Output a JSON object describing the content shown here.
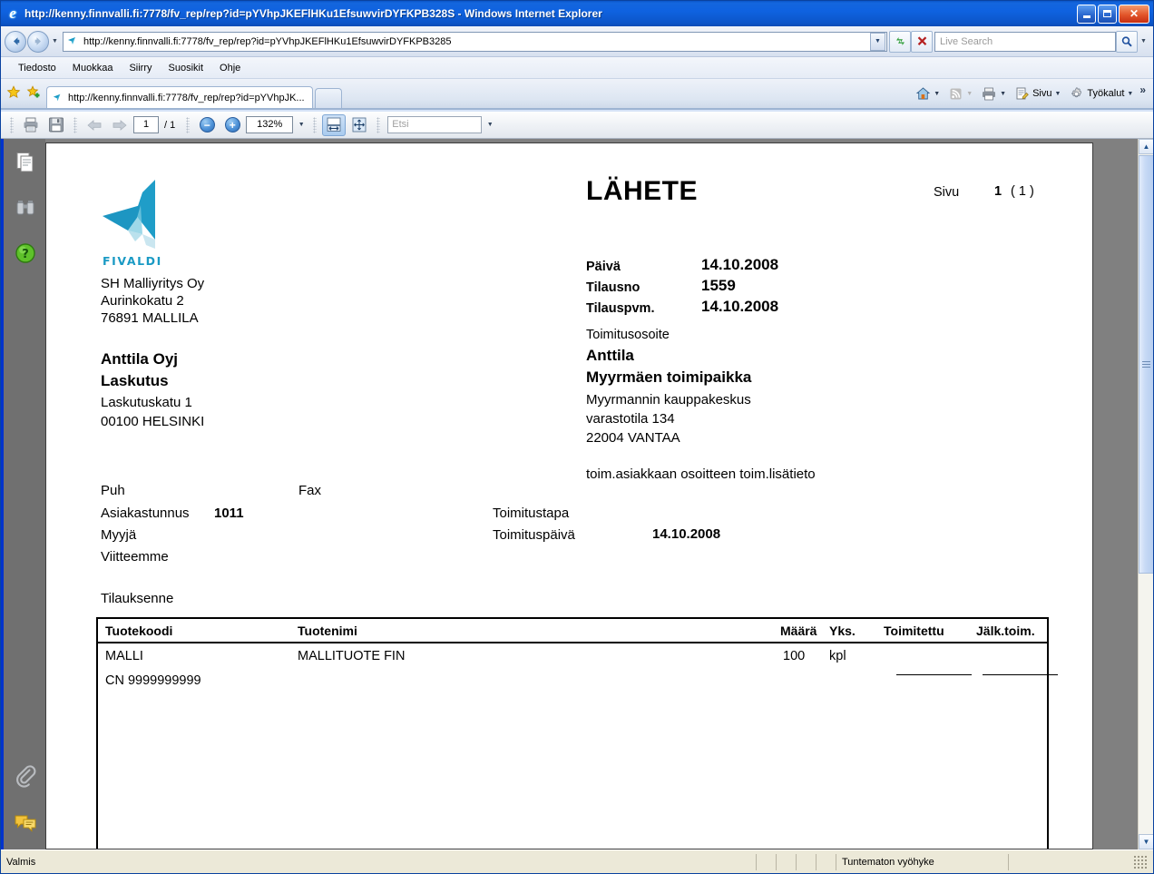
{
  "window": {
    "title": "http://kenny.finnvalli.fi:7778/fv_rep/rep?id=pYVhpJKEFlHKu1EfsuwvirDYFKPB328S - Windows Internet Explorer",
    "ie_logo_glyph": "e",
    "minimize_label": "Minimize",
    "maximize_label": "Maximize",
    "close_label": "✕"
  },
  "addressbar": {
    "back_glyph": "←",
    "forward_glyph": "→",
    "history_caret": "▼",
    "url": "http://kenny.finnvalli.fi:7778/fv_rep/rep?id=pYVhpJKEFlHKu1EfsuwvirDYFKPB3285",
    "url_caret": "▼",
    "refresh_glyph": "↺",
    "stop_glyph": "✕",
    "search_placeholder": "Live Search",
    "search_glyph": "🔍",
    "search_caret": "▼"
  },
  "menubar": {
    "items": [
      "Tiedosto",
      "Muokkaa",
      "Siirry",
      "Suosikit",
      "Ohje"
    ]
  },
  "tabbar": {
    "favorites_center_icon": "star-icon",
    "add_favorite_icon": "add-favorite-icon",
    "tab_label": "http://kenny.finnvalli.fi:7778/fv_rep/rep?id=pYVhpJK...",
    "newtab_label": "",
    "commands": [
      {
        "icon": "home-icon",
        "label": "",
        "caret": "▼"
      },
      {
        "icon": "feeds-icon",
        "label": "",
        "caret": "▼"
      },
      {
        "icon": "print-icon",
        "label": "",
        "caret": "▼"
      },
      {
        "icon": "page-icon",
        "label": "Sivu",
        "caret": "▼"
      },
      {
        "icon": "tools-icon",
        "label": "Työkalut",
        "caret": "▼"
      }
    ],
    "overflow": "»"
  },
  "pdftoolbar": {
    "print_icon": "print-icon",
    "save_icon": "save-icon",
    "prev_page_glyph": "⇦",
    "next_page_glyph": "⇨",
    "page_number": "1",
    "page_total": "/ 1",
    "zoom_out_glyph": "−",
    "zoom_in_glyph": "+",
    "zoom_level": "132%",
    "zoom_caret": "▼",
    "fit_width_icon": "fit-width-icon",
    "fit_page_icon": "fit-page-icon",
    "find_placeholder": "Etsi",
    "find_caret": "▼"
  },
  "navstrip": {
    "icons": [
      {
        "name": "pages-panel-icon",
        "title": "Sivut"
      },
      {
        "name": "binoculars-search-icon",
        "title": "Haku"
      },
      {
        "name": "help-icon",
        "title": "Ohje"
      },
      {
        "name": "attachments-icon",
        "title": "Liitteet"
      },
      {
        "name": "comments-icon",
        "title": "Kommentit"
      }
    ]
  },
  "scrollbar": {
    "up_glyph": "▲",
    "down_glyph": "▼"
  },
  "statusbar": {
    "left_text": "Valmis",
    "zone_text": "Tuntematon vyöhyke"
  },
  "document": {
    "logo": {
      "name": "fivaldi-logo",
      "wordmark": "FIVALDI",
      "color": "#1a9ac4"
    },
    "sender": {
      "lines": [
        "SH Malliyritys Oy",
        "Aurinkokatu 2",
        "76891 MALLILA"
      ]
    },
    "title": "LÄHETE",
    "page_label": "Sivu",
    "page_value": "1",
    "page_of": "( 1 )",
    "fields": [
      {
        "label": "Päivä",
        "value": "14.10.2008"
      },
      {
        "label": "Tilausno",
        "value": "1559"
      },
      {
        "label": "Tilauspvm.",
        "value": "14.10.2008"
      }
    ],
    "billing": {
      "name1": "Anttila Oyj",
      "name2": "Laskutus",
      "street": "Laskutuskatu 1",
      "city": "00100  HELSINKI"
    },
    "delivery": {
      "heading": "Toimitusosoite",
      "name1": "Anttila",
      "name2": "Myyrmäen toimipaikka",
      "line1": "Myyrmannin kauppakeskus",
      "line2": "varastotila 134",
      "line3": "22004  VANTAA",
      "note": "toim.asiakkaan osoitteen toim.lisätieto"
    },
    "contact": {
      "phone_label": "Puh",
      "phone_value": "",
      "fax_label": "Fax",
      "fax_value": "",
      "customer_no_label": "Asiakastunnus",
      "customer_no_value": "1011",
      "seller_label": "Myyjä",
      "seller_value": "",
      "our_ref_label": "Viitteemme",
      "our_ref_value": "",
      "your_order_label": "Tilauksenne",
      "your_order_value": "",
      "delivery_method_label": "Toimitustapa",
      "delivery_method_value": "",
      "delivery_date_label": "Toimituspäivä",
      "delivery_date_value": "14.10.2008"
    },
    "table": {
      "headers": {
        "code": "Tuotekoodi",
        "name": "Tuotenimi",
        "qty": "Määrä",
        "unit": "Yks.",
        "delivered": "Toimitettu",
        "backorder": "Jälk.toim."
      },
      "rows": [
        {
          "code": "MALLI",
          "name": "MALLITUOTE FIN",
          "qty": "100",
          "unit": "kpl",
          "delivered": "",
          "backorder": ""
        },
        {
          "code": "CN 9999999999",
          "name": "",
          "qty": "",
          "unit": "",
          "delivered": "",
          "backorder": ""
        }
      ]
    }
  }
}
